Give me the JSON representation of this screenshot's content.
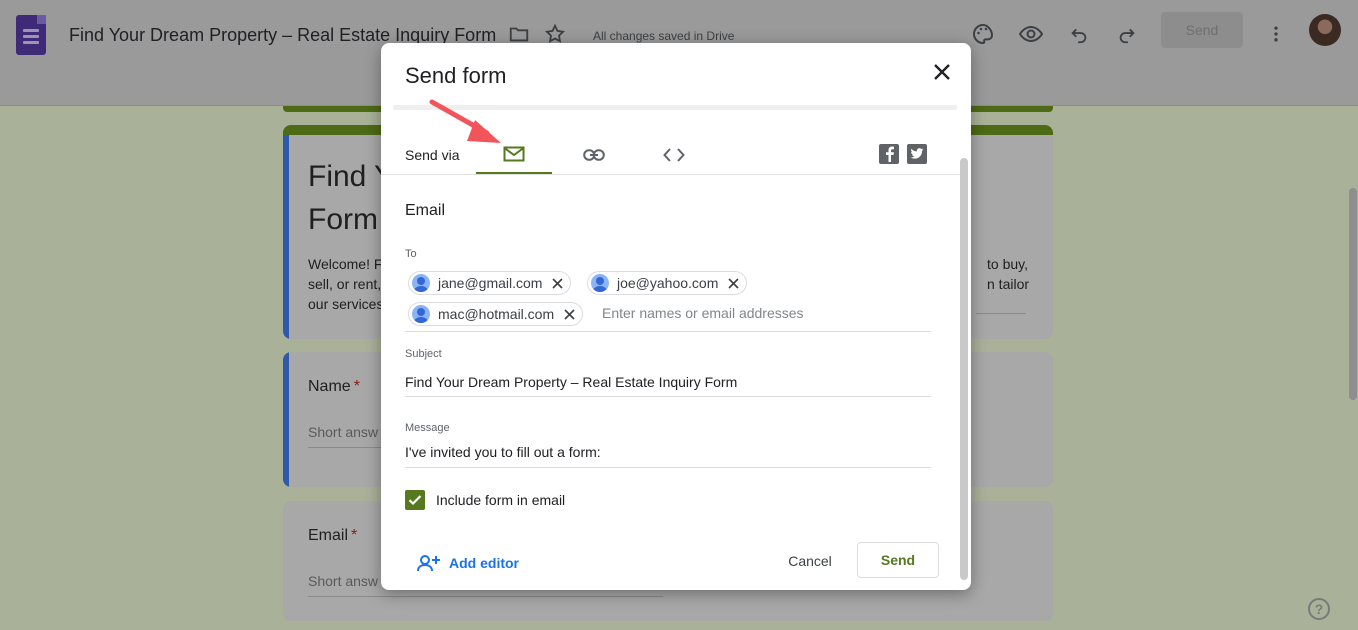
{
  "header": {
    "doc_title": "Find Your Dream Property – Real Estate Inquiry Form",
    "save_status": "All changes saved in Drive",
    "send_label": "Send",
    "icons": [
      "forms-logo-icon",
      "folder-icon",
      "star-icon",
      "palette-icon",
      "eye-icon",
      "undo-icon",
      "redo-icon",
      "more-vert-icon"
    ]
  },
  "background_form": {
    "title_line1": "Find Y",
    "title_line2": "Form",
    "description_line1": "Welcome! F",
    "description_line2": "sell, or rent,",
    "description_line3": "our services",
    "description_right1": "to buy,",
    "description_right2": "n tailor",
    "questions": [
      {
        "label": "Name",
        "required_mark": "*",
        "placeholder": "Short answ"
      },
      {
        "label": "Email",
        "required_mark": "*",
        "placeholder": "Short answ"
      }
    ]
  },
  "dialog": {
    "title": "Send form",
    "send_via_label": "Send via",
    "active_tab": "email",
    "section_title": "Email",
    "to_label": "To",
    "recipients": [
      "jane@gmail.com",
      "joe@yahoo.com",
      "mac@hotmail.com"
    ],
    "to_placeholder": "Enter names or email addresses",
    "subject_label": "Subject",
    "subject_value": "Find Your Dream Property – Real Estate Inquiry Form",
    "message_label": "Message",
    "message_value": "I've invited you to fill out a form:",
    "include_form_label": "Include form in email",
    "include_form_checked": true,
    "add_editor_label": "Add editor",
    "cancel_label": "Cancel",
    "send_label": "Send"
  },
  "colors": {
    "accent_green": "#56781f",
    "link_blue": "#1a73e8",
    "annotation_arrow": "#f2545b"
  }
}
